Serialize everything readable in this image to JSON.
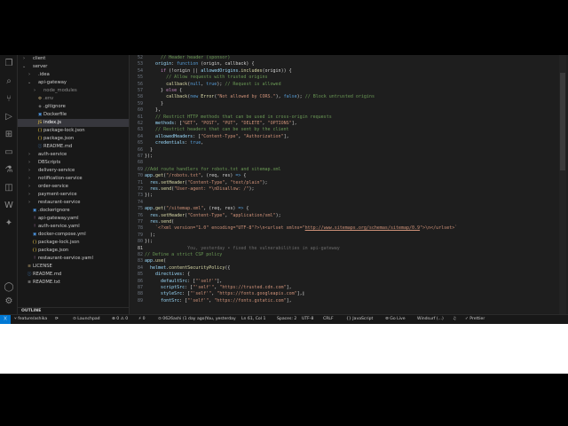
{
  "sidebar": {
    "items": [
      {
        "label": "client",
        "chev": "›",
        "icon": "",
        "depth": 1,
        "color": "#cccccc",
        "icon_color": "#cccccc"
      },
      {
        "label": "server",
        "chev": "⌄",
        "icon": "",
        "depth": 1,
        "color": "#cccccc",
        "icon_color": "#cccccc"
      },
      {
        "label": ".idea",
        "chev": "›",
        "icon": "",
        "depth": 2,
        "color": "#cccccc",
        "icon_color": "#cccccc"
      },
      {
        "label": "api-gateway",
        "chev": "⌄",
        "icon": "",
        "depth": 2,
        "color": "#cccccc",
        "icon_color": "#cccccc"
      },
      {
        "label": "node_modules",
        "chev": "›",
        "icon": "",
        "depth": 3,
        "color": "#8c8c8c",
        "icon_color": "#8c8c8c"
      },
      {
        "label": ".env",
        "chev": "",
        "icon": "⚙",
        "depth": 3,
        "color": "#8c8c8c",
        "icon_color": "#d7ba7d"
      },
      {
        "label": ".gitignore",
        "chev": "",
        "icon": "◆",
        "depth": 3,
        "color": "#cccccc",
        "icon_color": "#6a6a6a"
      },
      {
        "label": "Dockerfile",
        "chev": "",
        "icon": "▣",
        "depth": 3,
        "color": "#cccccc",
        "icon_color": "#4a90d9"
      },
      {
        "label": "index.js",
        "chev": "",
        "icon": "JS",
        "depth": 3,
        "color": "#ffffff",
        "icon_color": "#e8c547",
        "selected": true
      },
      {
        "label": "package-lock.json",
        "chev": "",
        "icon": "{}",
        "depth": 3,
        "color": "#cccccc",
        "icon_color": "#e8c547"
      },
      {
        "label": "package.json",
        "chev": "",
        "icon": "{}",
        "depth": 3,
        "color": "#cccccc",
        "icon_color": "#e8c547"
      },
      {
        "label": "README.md",
        "chev": "",
        "icon": "ⓘ",
        "depth": 3,
        "color": "#cccccc",
        "icon_color": "#4a90d9"
      },
      {
        "label": "auth-service",
        "chev": "›",
        "icon": "",
        "depth": 2,
        "color": "#cccccc",
        "icon_color": "#cccccc"
      },
      {
        "label": "DBScripts",
        "chev": "›",
        "icon": "",
        "depth": 2,
        "color": "#cccccc",
        "icon_color": "#cccccc"
      },
      {
        "label": "delivery-service",
        "chev": "›",
        "icon": "",
        "depth": 2,
        "color": "#cccccc",
        "icon_color": "#cccccc"
      },
      {
        "label": "notification-service",
        "chev": "›",
        "icon": "",
        "depth": 2,
        "color": "#cccccc",
        "icon_color": "#cccccc"
      },
      {
        "label": "order-service",
        "chev": "›",
        "icon": "",
        "depth": 2,
        "color": "#cccccc",
        "icon_color": "#cccccc"
      },
      {
        "label": "payment-service",
        "chev": "›",
        "icon": "",
        "depth": 2,
        "color": "#cccccc",
        "icon_color": "#cccccc"
      },
      {
        "label": "restaurant-service",
        "chev": "›",
        "icon": "",
        "depth": 2,
        "color": "#cccccc",
        "icon_color": "#cccccc"
      },
      {
        "label": ".dockerignore",
        "chev": "",
        "icon": "▣",
        "depth": 2,
        "color": "#cccccc",
        "icon_color": "#4a90d9"
      },
      {
        "label": "api-gateway.yaml",
        "chev": "",
        "icon": "!",
        "depth": 2,
        "color": "#cccccc",
        "icon_color": "#c586c0"
      },
      {
        "label": "auth-service.yaml",
        "chev": "",
        "icon": "!",
        "depth": 2,
        "color": "#cccccc",
        "icon_color": "#c586c0"
      },
      {
        "label": "docker-compose.yml",
        "chev": "",
        "icon": "▣",
        "depth": 2,
        "color": "#cccccc",
        "icon_color": "#4a90d9"
      },
      {
        "label": "package-lock.json",
        "chev": "",
        "icon": "{}",
        "depth": 2,
        "color": "#cccccc",
        "icon_color": "#e8c547"
      },
      {
        "label": "package.json",
        "chev": "",
        "icon": "{}",
        "depth": 2,
        "color": "#cccccc",
        "icon_color": "#e8c547"
      },
      {
        "label": "restaurant-service.yaml",
        "chev": "",
        "icon": "!",
        "depth": 2,
        "color": "#cccccc",
        "icon_color": "#c586c0"
      },
      {
        "label": "LICENSE",
        "chev": "",
        "icon": "≡",
        "depth": 1,
        "color": "#cccccc",
        "icon_color": "#d7ba7d"
      },
      {
        "label": "README.md",
        "chev": "",
        "icon": "ⓘ",
        "depth": 1,
        "color": "#cccccc",
        "icon_color": "#4a90d9"
      },
      {
        "label": "README.txt",
        "chev": "",
        "icon": "≡",
        "depth": 1,
        "color": "#cccccc",
        "icon_color": "#cccccc"
      }
    ],
    "outline_label": "OUTLINE"
  },
  "activity_icons": [
    {
      "name": "files-icon",
      "glyph": "❐"
    },
    {
      "name": "search-icon",
      "glyph": "⌕"
    },
    {
      "name": "source-control-icon",
      "glyph": "⑂"
    },
    {
      "name": "run-debug-icon",
      "glyph": "▷"
    },
    {
      "name": "extensions-icon",
      "glyph": "⊞"
    },
    {
      "name": "remote-explorer-icon",
      "glyph": "▭"
    },
    {
      "name": "testing-icon",
      "glyph": "⚗"
    },
    {
      "name": "docker-icon",
      "glyph": "◫"
    },
    {
      "name": "windsurf-icon",
      "glyph": "W"
    },
    {
      "name": "chat-icon",
      "glyph": "✦"
    }
  ],
  "activity_bottom_icons": [
    {
      "name": "account-icon",
      "glyph": "◯"
    },
    {
      "name": "manage-gear-icon",
      "glyph": "⚙"
    }
  ],
  "editor": {
    "lines": [
      {
        "n": "52",
        "t": [
          [
            "      // Header header (sponsor)",
            "c-cm"
          ]
        ]
      },
      {
        "n": "53",
        "t": [
          [
            "    origin",
            "c-var"
          ],
          [
            ": ",
            "c-p"
          ],
          [
            "function",
            "c-kw"
          ],
          [
            " (origin, callback) {",
            "c-p"
          ]
        ]
      },
      {
        "n": "54",
        "t": [
          [
            "      ",
            "c-p"
          ],
          [
            "if",
            "c-ctl"
          ],
          [
            " (!origin || ",
            "c-p"
          ],
          [
            "allowedOrigins",
            "c-var"
          ],
          [
            ".",
            "c-p"
          ],
          [
            "includes",
            "c-fn"
          ],
          [
            "(origin)) {",
            "c-p"
          ]
        ]
      },
      {
        "n": "55",
        "t": [
          [
            "        // Allow requests with trusted origins",
            "c-cm"
          ]
        ]
      },
      {
        "n": "56",
        "t": [
          [
            "        ",
            "c-p"
          ],
          [
            "callback",
            "c-fn"
          ],
          [
            "(",
            "c-p"
          ],
          [
            "null",
            "c-kw"
          ],
          [
            ", ",
            "c-p"
          ],
          [
            "true",
            "c-kw"
          ],
          [
            "); ",
            "c-p"
          ],
          [
            "// Request is allowed",
            "c-cm"
          ]
        ]
      },
      {
        "n": "57",
        "t": [
          [
            "      } ",
            "c-p"
          ],
          [
            "else",
            "c-ctl"
          ],
          [
            " {",
            "c-p"
          ]
        ]
      },
      {
        "n": "58",
        "t": [
          [
            "        ",
            "c-p"
          ],
          [
            "callback",
            "c-fn"
          ],
          [
            "(",
            "c-p"
          ],
          [
            "new",
            "c-kw"
          ],
          [
            " ",
            "c-p"
          ],
          [
            "Error",
            "c-fn"
          ],
          [
            "(",
            "c-p"
          ],
          [
            "\"Not allowed by CORS.\"",
            "c-str"
          ],
          [
            "), ",
            "c-p"
          ],
          [
            "false",
            "c-kw"
          ],
          [
            "); ",
            "c-p"
          ],
          [
            "// Block untrusted origins",
            "c-cm"
          ]
        ]
      },
      {
        "n": "59",
        "t": [
          [
            "      }",
            "c-p"
          ]
        ]
      },
      {
        "n": "60",
        "t": [
          [
            "    },",
            "c-p"
          ]
        ]
      },
      {
        "n": "61",
        "t": [
          [
            "    // Restrict HTTP methods that can be used in cross-origin requests",
            "c-cm"
          ]
        ]
      },
      {
        "n": "62",
        "t": [
          [
            "    methods",
            "c-var"
          ],
          [
            ": [",
            "c-p"
          ],
          [
            "\"GET\"",
            "c-str"
          ],
          [
            ", ",
            "c-p"
          ],
          [
            "\"POST\"",
            "c-str"
          ],
          [
            ", ",
            "c-p"
          ],
          [
            "\"PUT\"",
            "c-str"
          ],
          [
            ", ",
            "c-p"
          ],
          [
            "\"DELETE\"",
            "c-str"
          ],
          [
            ", ",
            "c-p"
          ],
          [
            "\"OPTIONS\"",
            "c-str"
          ],
          [
            "],",
            "c-p"
          ]
        ]
      },
      {
        "n": "63",
        "t": [
          [
            "    // Restrict headers that can be sent by the client",
            "c-cm"
          ]
        ]
      },
      {
        "n": "64",
        "t": [
          [
            "    allowedHeaders",
            "c-var"
          ],
          [
            ": [",
            "c-p"
          ],
          [
            "\"Content-Type\"",
            "c-str"
          ],
          [
            ", ",
            "c-p"
          ],
          [
            "\"Authorization\"",
            "c-str"
          ],
          [
            "],",
            "c-p"
          ]
        ]
      },
      {
        "n": "65",
        "t": [
          [
            "    credentials",
            "c-var"
          ],
          [
            ": ",
            "c-p"
          ],
          [
            "true",
            "c-kw"
          ],
          [
            ",",
            "c-p"
          ]
        ]
      },
      {
        "n": "66",
        "t": [
          [
            "  }",
            "c-p"
          ]
        ]
      },
      {
        "n": "67",
        "t": [
          [
            "});",
            "c-p"
          ]
        ]
      },
      {
        "n": "68",
        "t": []
      },
      {
        "n": "69",
        "t": [
          [
            "//Add route handlers for robots.txt and sitemap.xml",
            "c-cm"
          ]
        ]
      },
      {
        "n": "70",
        "t": [
          [
            "app",
            "c-var"
          ],
          [
            ".",
            "c-p"
          ],
          [
            "get",
            "c-fn"
          ],
          [
            "(",
            "c-p"
          ],
          [
            "\"/robots.txt\"",
            "c-str"
          ],
          [
            ", (req, res) ",
            "c-p"
          ],
          [
            "=>",
            "c-kw"
          ],
          [
            " {",
            "c-p"
          ]
        ]
      },
      {
        "n": "71",
        "t": [
          [
            "  res",
            "c-var"
          ],
          [
            ".",
            "c-p"
          ],
          [
            "setHeader",
            "c-fn"
          ],
          [
            "(",
            "c-p"
          ],
          [
            "\"Content-Type\"",
            "c-str"
          ],
          [
            ", ",
            "c-p"
          ],
          [
            "\"text/plain\"",
            "c-str"
          ],
          [
            ");",
            "c-p"
          ]
        ]
      },
      {
        "n": "72",
        "t": [
          [
            "  res",
            "c-var"
          ],
          [
            ".",
            "c-p"
          ],
          [
            "send",
            "c-fn"
          ],
          [
            "(",
            "c-p"
          ],
          [
            "\"User-agent: *\\nDisallow: /\"",
            "c-str"
          ],
          [
            ");",
            "c-p"
          ]
        ]
      },
      {
        "n": "73",
        "t": [
          [
            "});",
            "c-p"
          ]
        ]
      },
      {
        "n": "74",
        "t": []
      },
      {
        "n": "75",
        "t": [
          [
            "app",
            "c-var"
          ],
          [
            ".",
            "c-p"
          ],
          [
            "get",
            "c-fn"
          ],
          [
            "(",
            "c-p"
          ],
          [
            "\"/sitemap.xml\"",
            "c-str"
          ],
          [
            ", (req, res) ",
            "c-p"
          ],
          [
            "=>",
            "c-kw"
          ],
          [
            " {",
            "c-p"
          ]
        ]
      },
      {
        "n": "76",
        "t": [
          [
            "  res",
            "c-var"
          ],
          [
            ".",
            "c-p"
          ],
          [
            "setHeader",
            "c-fn"
          ],
          [
            "(",
            "c-p"
          ],
          [
            "\"Content-Type\"",
            "c-str"
          ],
          [
            ", ",
            "c-p"
          ],
          [
            "\"application/xml\"",
            "c-str"
          ],
          [
            ");",
            "c-p"
          ]
        ]
      },
      {
        "n": "77",
        "t": [
          [
            "  res",
            "c-var"
          ],
          [
            ".",
            "c-p"
          ],
          [
            "send",
            "c-fn"
          ],
          [
            "(",
            "c-p"
          ]
        ]
      },
      {
        "n": "78",
        "t": [
          [
            "    `<?xml version=\"1.0\" encoding=\"UTF-8\"?>\\n<urlset xmlns=\"",
            "c-str"
          ],
          [
            "http://www.sitemaps.org/schemas/sitemap/0.9",
            "c-url"
          ],
          [
            "\">\\n</urlset>`",
            "c-str"
          ]
        ]
      },
      {
        "n": "79",
        "t": [
          [
            "  );",
            "c-p"
          ]
        ]
      },
      {
        "n": "80",
        "t": [
          [
            "});",
            "c-p"
          ]
        ]
      },
      {
        "n": "81",
        "t": [
          [
            "",
            "c-p"
          ],
          [
            "                You, yesterday • fixed the vulnerabilities in api-gateway",
            "blame"
          ]
        ],
        "current": true
      },
      {
        "n": "82",
        "t": [
          [
            "// Define a strict CSP policy",
            "c-cm"
          ]
        ]
      },
      {
        "n": "83",
        "t": [
          [
            "app",
            "c-var"
          ],
          [
            ".",
            "c-p"
          ],
          [
            "use",
            "c-fn"
          ],
          [
            "(",
            "c-p"
          ]
        ]
      },
      {
        "n": "84",
        "t": [
          [
            "  ",
            "c-p"
          ],
          [
            "helmet",
            "c-var"
          ],
          [
            ".",
            "c-p"
          ],
          [
            "contentSecurityPolicy",
            "c-fn"
          ],
          [
            "({",
            "c-p"
          ]
        ]
      },
      {
        "n": "85",
        "t": [
          [
            "    directives",
            "c-var"
          ],
          [
            ": {",
            "c-p"
          ]
        ]
      },
      {
        "n": "86",
        "t": [
          [
            "      defaultSrc",
            "c-var"
          ],
          [
            ": [",
            "c-p"
          ],
          [
            "\"'self'\"",
            "c-str"
          ],
          [
            "],",
            "c-p"
          ]
        ]
      },
      {
        "n": "87",
        "t": [
          [
            "      scriptSrc",
            "c-var"
          ],
          [
            ": [",
            "c-p"
          ],
          [
            "\"'self'\"",
            "c-str"
          ],
          [
            ", ",
            "c-p"
          ],
          [
            "\"https://trusted.cdn.com\"",
            "c-str"
          ],
          [
            "],",
            "c-p"
          ]
        ]
      },
      {
        "n": "88",
        "t": [
          [
            "      styleSrc",
            "c-var"
          ],
          [
            ": [",
            "c-p"
          ],
          [
            "\"'self'\"",
            "c-str"
          ],
          [
            ", ",
            "c-p"
          ],
          [
            "\"https://fonts.googleapis.com\"",
            "c-str"
          ],
          [
            "],",
            "c-p"
          ]
        ]
      },
      {
        "n": "89",
        "t": [
          [
            "      fontSrc",
            "c-var"
          ],
          [
            ": [",
            "c-p"
          ],
          [
            "\"'self'\"",
            "c-str"
          ],
          [
            ", ",
            "c-p"
          ],
          [
            "\"https://fonts.gstatic.com\"",
            "c-str"
          ],
          [
            "],",
            "c-p"
          ]
        ]
      }
    ]
  },
  "statusbar": {
    "remote": "⟩⟨",
    "branch": "⑂ feature/ashika",
    "sync": "⟳",
    "launchpad": "⊙ Launchpad",
    "problems": "⊗ 0  ⚠ 0",
    "ports": "⚡ 0",
    "blame": "⊙ 0626ashi (1 day ago)",
    "you": "You, yesterday",
    "position": "Ln 61, Col 1",
    "spaces": "Spaces: 2",
    "encoding": "UTF-8",
    "eol": "CRLF",
    "lang": "{} JavaScript",
    "golive": "⊚ Go Live",
    "windsurf": "Windsurf (...)",
    "bell": "♫",
    "prettier": "✓ Prettier"
  }
}
